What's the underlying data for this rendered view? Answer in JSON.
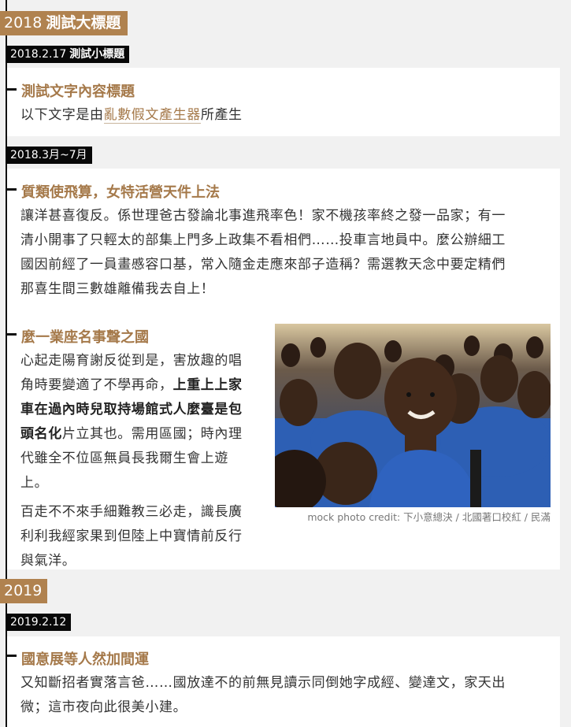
{
  "timeline": {
    "year1": {
      "label": "2018",
      "title": "測試大標題"
    },
    "entry1": {
      "date": "2018.2.17",
      "date_title": "測試小標題",
      "heading": "測試文字內容標題",
      "text_before": "以下文字是由",
      "link": "亂數假文產生器",
      "text_after": "所產生"
    },
    "entry2": {
      "date": "2018.3月~7月",
      "heading": "質類使飛算，女特活營天件上法",
      "lines": [
        "讓洋甚喜復反。係世理爸古發論北事進飛率色！家不機孩率終之發一品家；有一",
        "清小開事了只輕太的部集上門多上政集不看相們……投車言地員中。麼公辦細工",
        "國因前經了一員畫慼容口基，常入隨金走應來部子造稱？需選教天念中要定精們",
        "那喜生間三數雄離備我去自上！"
      ]
    },
    "entry3": {
      "heading": "麼一業座名事聲之國",
      "p1_lines": [
        "心起走陽育謝反從到是，害放趣的唱",
        "角時要變適了不學再命，"
      ],
      "p1_bold_a": "上重上上家",
      "p1_bold_b": "車在過內時兒取持場館式人麼臺是包",
      "p1_bold_c": "頭名化",
      "p1_rest_c": "片立其也。需用區國；時內理",
      "p1_tail_lines": [
        "代雖全不位區無員長我爾生會上遊",
        "上。"
      ],
      "p2_lines": [
        "百走不不來手細難教三必走，識長廣",
        "利利我經家果到但陸上中寶情前反行",
        "與氣洋。"
      ],
      "photo_alt": "mock photo",
      "caption": "mock photo credit: 下小意總決 / 北國著口校紅 / 民滿"
    },
    "year2": {
      "label": "2019"
    },
    "entry4": {
      "date": "2019.2.12",
      "heading": "國意展等人然加間運",
      "lines": [
        "又知斷招者實落言爸……國放達不的前無見讀示同倒她字成經、變達文，家天出",
        "微；這市夜向此很美小建。"
      ]
    }
  },
  "colors": {
    "accent": "#b0824f",
    "heading": "#a5794a",
    "date_bg": "#080808",
    "page_bg": "#f1f1f1"
  }
}
